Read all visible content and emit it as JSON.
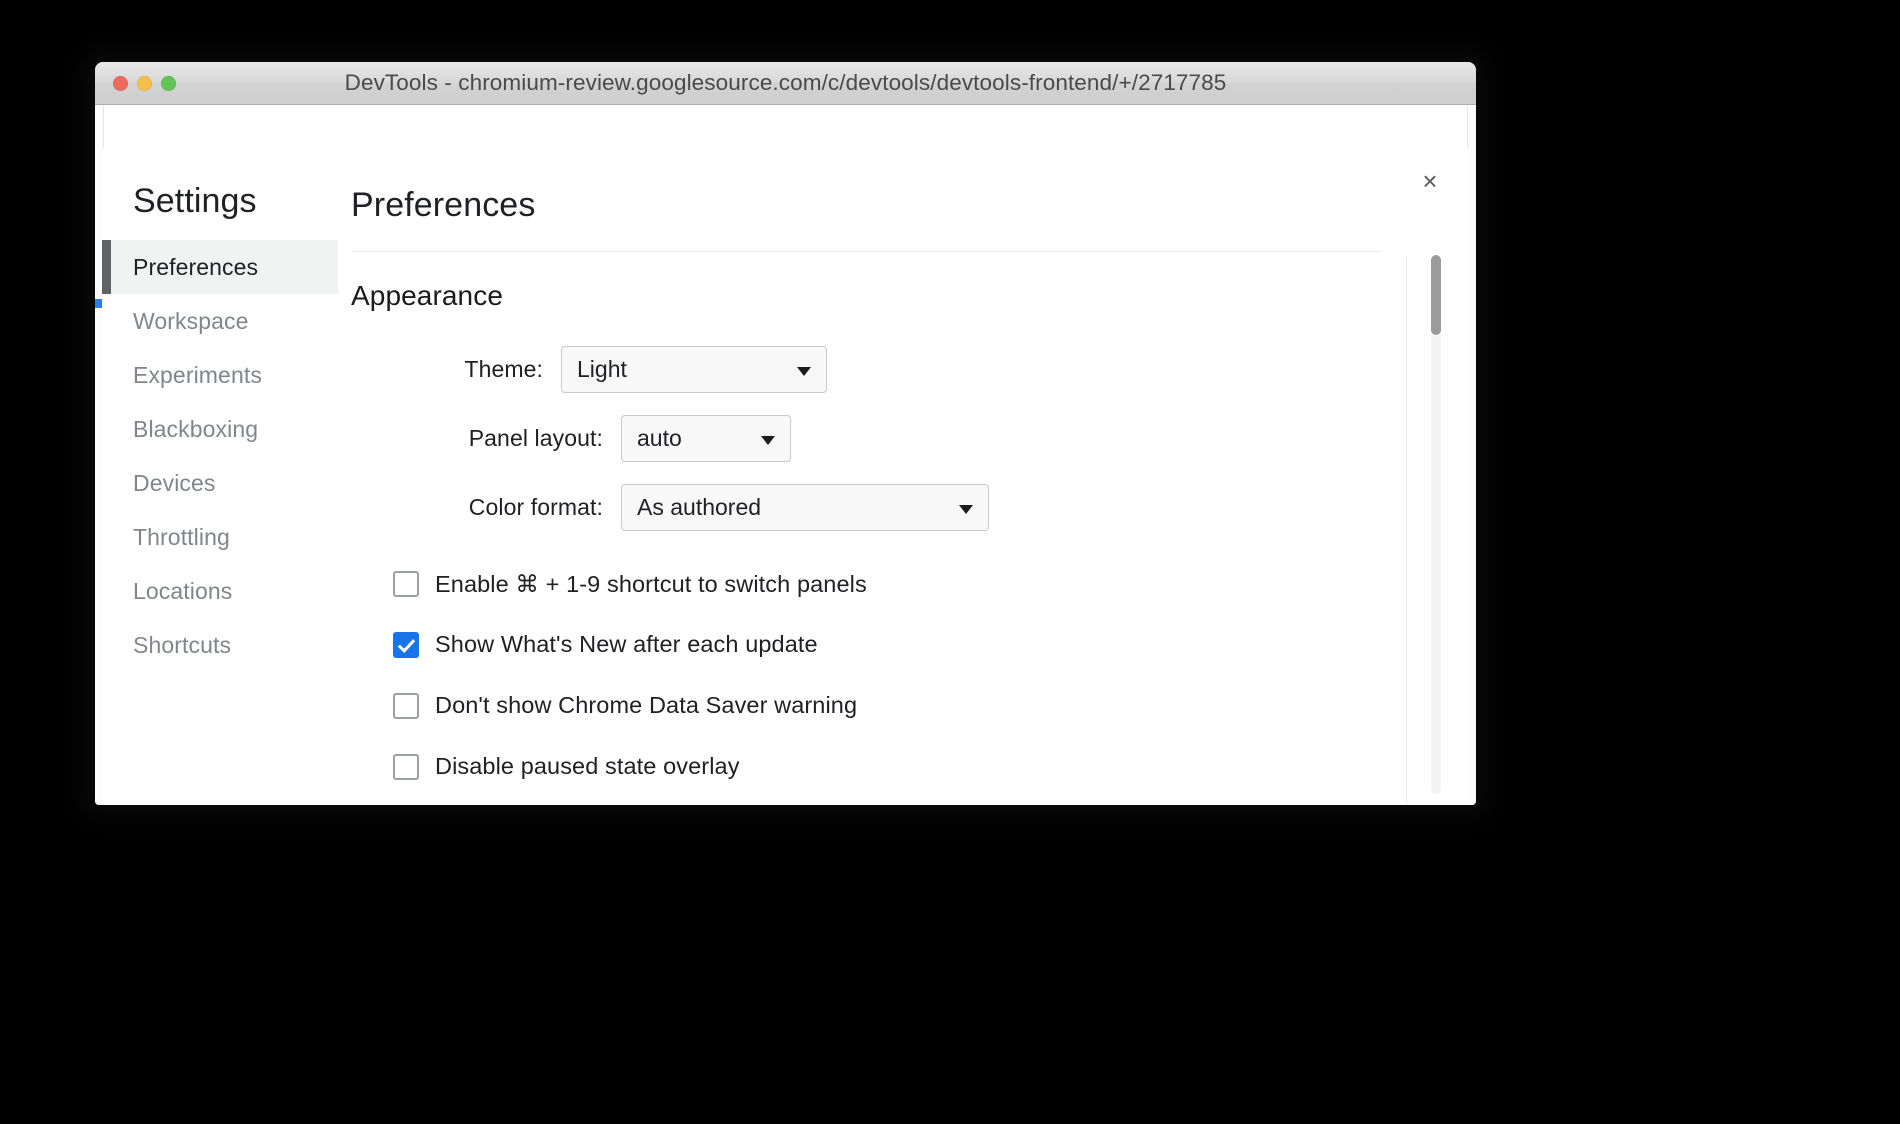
{
  "window": {
    "title": "DevTools - chromium-review.googlesource.com/c/devtools/devtools-frontend/+/2717785",
    "traffic_lights": {
      "close": "close-button",
      "minimize": "minimize-button",
      "maximize": "maximize-button"
    },
    "colors": {
      "close": "#ec6a5e",
      "minimize": "#f4bf4f",
      "maximize": "#61c454"
    }
  },
  "dialog": {
    "close_label": "×"
  },
  "sidebar": {
    "heading": "Settings",
    "items": [
      {
        "label": "Preferences",
        "selected": true
      },
      {
        "label": "Workspace",
        "selected": false
      },
      {
        "label": "Experiments",
        "selected": false
      },
      {
        "label": "Blackboxing",
        "selected": false
      },
      {
        "label": "Devices",
        "selected": false
      },
      {
        "label": "Throttling",
        "selected": false
      },
      {
        "label": "Locations",
        "selected": false
      },
      {
        "label": "Shortcuts",
        "selected": false
      }
    ]
  },
  "main": {
    "title": "Preferences",
    "sections": [
      {
        "title": "Appearance",
        "selects": [
          {
            "label": "Theme:",
            "value": "Light"
          },
          {
            "label": "Panel layout:",
            "value": "auto"
          },
          {
            "label": "Color format:",
            "value": "As authored"
          }
        ],
        "checkboxes": [
          {
            "label": "Enable ⌘ + 1-9 shortcut to switch panels",
            "checked": false,
            "struck": false
          },
          {
            "label": "Show What's New after each update",
            "checked": true,
            "struck": false
          },
          {
            "label": "Don't show Chrome Data Saver warning",
            "checked": false,
            "struck": true
          },
          {
            "label": "Disable paused state overlay",
            "checked": false,
            "struck": false
          }
        ]
      }
    ]
  },
  "annotation": {
    "strike_color": "#fb0007"
  },
  "accent": {
    "checkbox_blue": "#1a73e8",
    "marker_blue": "#2c7ef0",
    "selected_bar": "#5f6368"
  }
}
